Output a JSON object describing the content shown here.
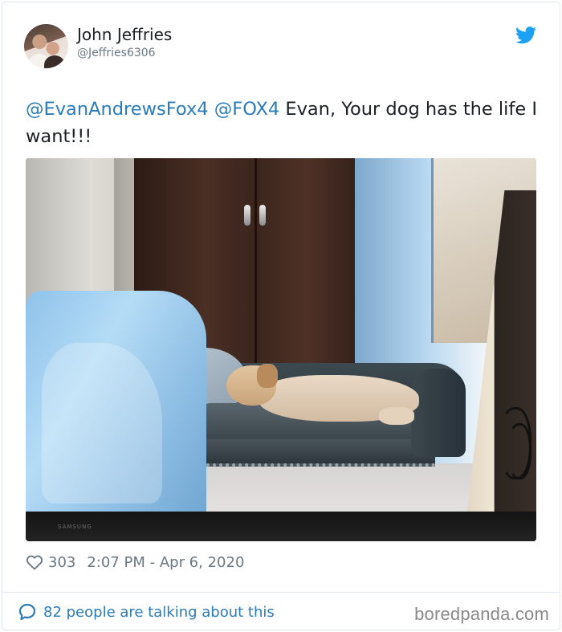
{
  "tweet": {
    "author_name": "John Jeffries",
    "author_handle": "@Jeffries6306",
    "mention_1": "@EvanAndrewsFox4",
    "mention_2": "@FOX4",
    "text_line": "Evan, Your dog has the life I want!!!",
    "likes": "303",
    "timestamp": "2:07 PM - Apr 6, 2020",
    "talking": "82 people are talking about this"
  },
  "photo": {
    "tv_brand": "SAMSUNG"
  },
  "footer": {
    "watermark": "boredpanda.com"
  },
  "icons": {
    "platform": "twitter-bird-icon",
    "like": "heart-icon",
    "reply": "speech-bubble-icon"
  },
  "colors": {
    "link": "#2b7bb9",
    "muted": "#697882",
    "twitter_blue": "#1da1f2",
    "border": "#e1e8ed"
  }
}
